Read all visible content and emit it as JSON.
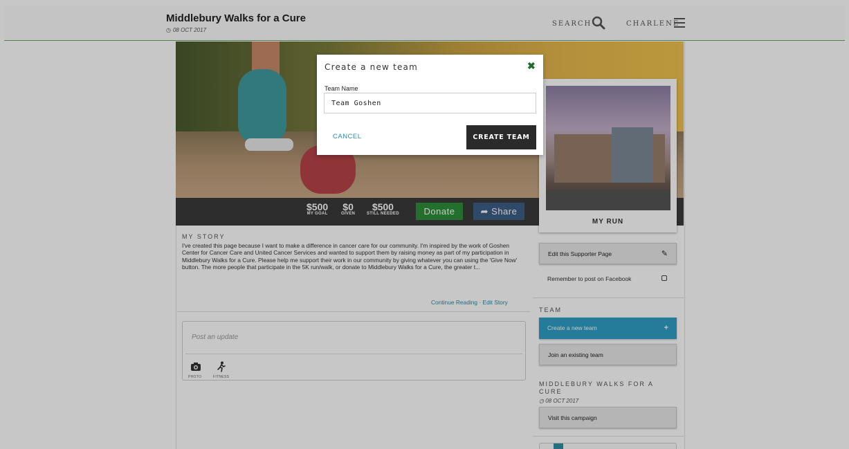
{
  "header": {
    "title": "Middlebury Walks for a Cure",
    "date": "08 OCT 2017",
    "search_label": "SEARCH",
    "user_label": "CHARLENE"
  },
  "stats": {
    "my_goal_value": "$500",
    "my_goal_label": "MY GOAL",
    "given_value": "$0",
    "given_label": "GIVEN",
    "needed_value": "$500",
    "needed_label": "STILL NEEDED",
    "donate_label": "Donate",
    "share_label": "Share"
  },
  "story": {
    "heading": "MY STORY",
    "text": "I've created this page because I want to make a difference in cancer care for our community. I'm inspired by the work of Goshen Center for Cancer Care and United Cancer Services and wanted to support them by raising money as part of my participation in Middlebury Walks for a Cure. Please help me support their work in our community by giving whatever you can using the 'Give Now' button. The more people that participate in the 5K run/walk, or donate to Middlebury Walks for a Cure, the greater t...",
    "continue_label": "Continue Reading",
    "separator": "·",
    "edit_label": "Edit Story"
  },
  "update": {
    "placeholder": "Post an update",
    "photo_label": "PHOTO",
    "fitness_label": "FITNESS"
  },
  "sidebar": {
    "photo_caption": "MY RUN",
    "edit_page_label": "Edit this Supporter Page",
    "remember_label": "Remember to post on Facebook",
    "team_heading": "TEAM",
    "create_team_label": "Create a new team",
    "join_team_label": "Join an existing team",
    "campaign_title": "MIDDLEBURY WALKS FOR A CURE",
    "campaign_date": "08 OCT 2017",
    "visit_label": "Visit this campaign"
  },
  "modal": {
    "title": "Create a new team",
    "field_label": "Team Name",
    "field_value": "Team Goshen",
    "cancel_label": "CANCEL",
    "create_label": "CREATE TEAM"
  },
  "colors": {
    "donate": "#2f8f3a",
    "share": "#3d5e86",
    "accent_blue": "#2f9fc6",
    "link": "#2a8aa5",
    "header_rule": "#6fa66a"
  }
}
